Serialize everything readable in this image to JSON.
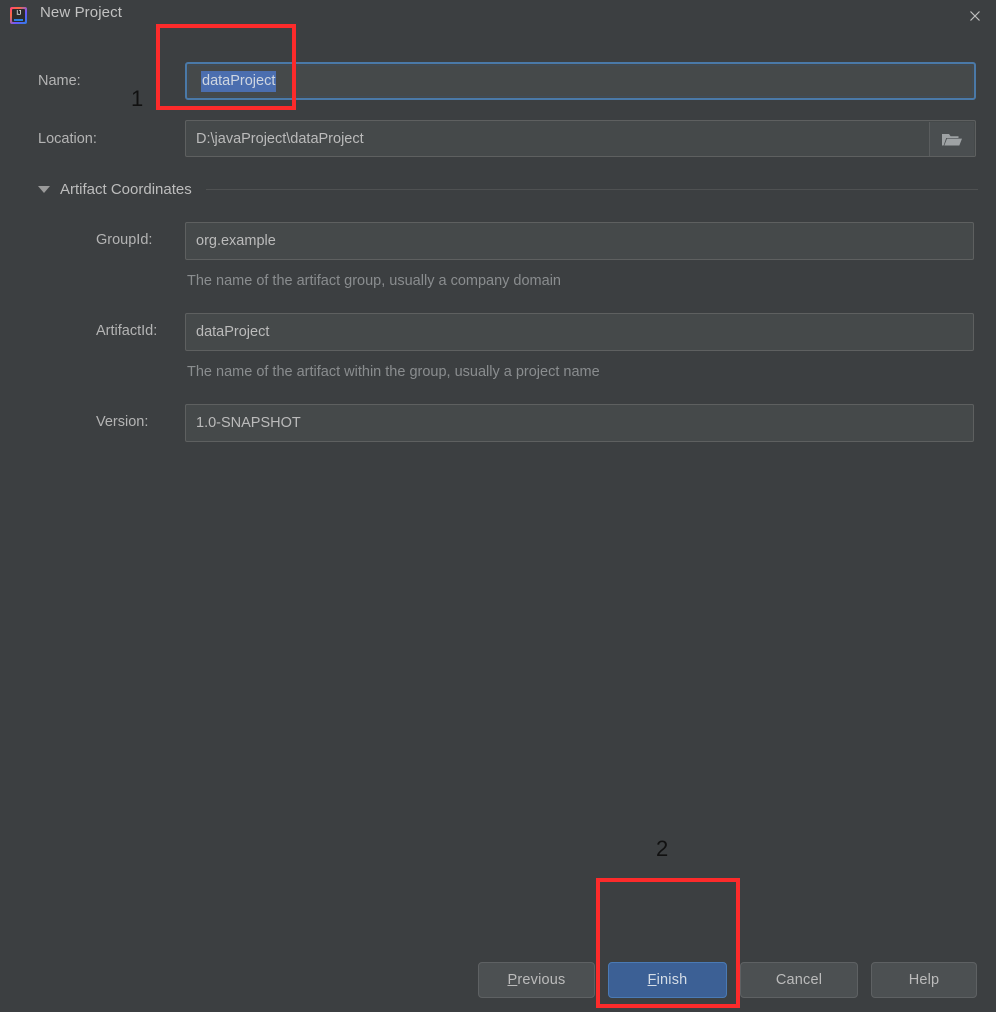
{
  "window": {
    "title": "New Project",
    "app_icon": "intellij-idea-icon",
    "close_icon": "close-icon"
  },
  "form": {
    "name": {
      "label": "Name:",
      "value": "dataProject",
      "selected": true,
      "focused": true
    },
    "location": {
      "label": "Location:",
      "value": "D:\\javaProject\\dataProject",
      "browse_icon": "folder-icon"
    }
  },
  "artifact_section": {
    "title": "Artifact Coordinates",
    "expanded": true,
    "expander_icon": "triangle-down-icon",
    "group_id": {
      "label": "GroupId:",
      "value": "org.example",
      "hint": "The name of the artifact group, usually a company domain"
    },
    "artifact_id": {
      "label": "ArtifactId:",
      "value": "dataProject",
      "hint": "The name of the artifact within the group, usually a project name"
    },
    "version": {
      "label": "Version:",
      "value": "1.0-SNAPSHOT"
    }
  },
  "buttons": {
    "previous": {
      "mnemonic": "P",
      "rest": "revious"
    },
    "finish": {
      "mnemonic": "F",
      "rest": "inish",
      "primary": true
    },
    "cancel": {
      "label": "Cancel"
    },
    "help": {
      "label": "Help"
    }
  },
  "annotations": {
    "one": "1",
    "two": "2",
    "color": "#fc2b2b"
  },
  "colors": {
    "dialog_bg": "#3c3f41",
    "field_bg": "#45494a",
    "focus_border": "#4a79a8",
    "selection_bg": "#4b6eaf",
    "primary_button": "#3c6095",
    "text": "#bbbbbb",
    "hint_text": "#8a8d8f"
  }
}
